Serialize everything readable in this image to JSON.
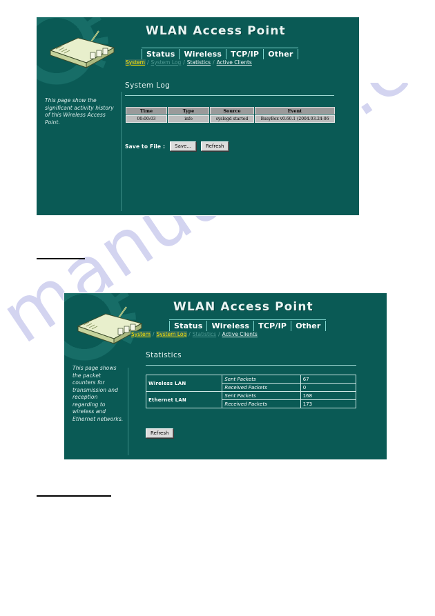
{
  "watermark": {
    "text": "manualslib.com"
  },
  "device_image": {
    "alt": "wireless-access-point-device"
  },
  "panels": [
    {
      "id": "system-log",
      "title": "WLAN Access Point",
      "tabs": [
        "Status",
        "Wireless",
        "TCP/IP",
        "Other"
      ],
      "subnav": [
        {
          "label": "System",
          "state": "active"
        },
        {
          "label": "System Log",
          "state": "dim"
        },
        {
          "label": "Statistics",
          "state": "plain"
        },
        {
          "label": "Active Clients",
          "state": "plain"
        }
      ],
      "subnav_separator": "/",
      "sidebar_note": "This page show the significant activity history of this Wireless Access Point.",
      "section_title": "System Log",
      "table": {
        "headers": [
          "Time",
          "Type",
          "Source",
          "Event"
        ],
        "rows": [
          [
            "00:00:03",
            "info",
            "syslogd started",
            "BusyBox v0.60.1 (2004.03.24-06"
          ]
        ]
      },
      "save_label": "Save to File :",
      "buttons": [
        "Save...",
        "Refresh"
      ]
    },
    {
      "id": "statistics",
      "title": "WLAN Access Point",
      "tabs": [
        "Status",
        "Wireless",
        "TCP/IP",
        "Other"
      ],
      "subnav": [
        {
          "label": "System",
          "state": "visited"
        },
        {
          "label": "System Log",
          "state": "active"
        },
        {
          "label": "Statistics",
          "state": "dim"
        },
        {
          "label": "Active Clients",
          "state": "plain"
        }
      ],
      "subnav_separator": "/",
      "sidebar_note": "This page shows the packet counters for transmission and reception regarding to wireless and Ethernet networks.",
      "section_title": "Statistics",
      "stats": [
        {
          "group": "Wireless LAN",
          "rows": [
            {
              "label": "Sent Packets",
              "value": "67"
            },
            {
              "label": "Received Packets",
              "value": "0"
            }
          ]
        },
        {
          "group": "Ethernet LAN",
          "rows": [
            {
              "label": "Sent Packets",
              "value": "168"
            },
            {
              "label": "Received Packets",
              "value": "173"
            }
          ]
        }
      ],
      "buttons": [
        "Refresh"
      ]
    }
  ],
  "colors": {
    "panel_background": "#0a5a55",
    "title_text": "#e9f5f3",
    "active_link": "#ffe400",
    "table_header": "#9a9a9a",
    "table_cell": "#bdbdbd"
  }
}
